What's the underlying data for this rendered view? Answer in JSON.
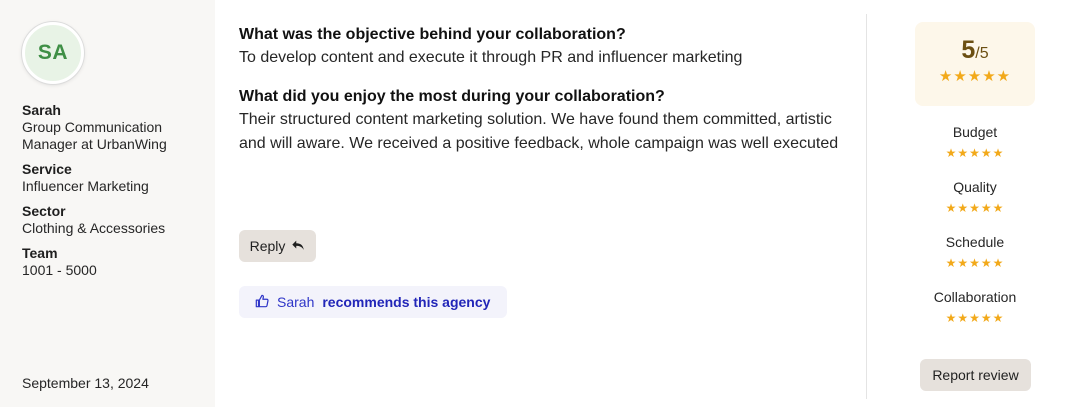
{
  "reviewer": {
    "initials": "SA",
    "name": "Sarah",
    "role": "Group Communication Manager at UrbanWing",
    "service_label": "Service",
    "service": "Influencer Marketing",
    "sector_label": "Sector",
    "sector": "Clothing & Accessories",
    "team_label": "Team",
    "team": "1001 - 5000",
    "date": "September 13, 2024"
  },
  "review": {
    "q1": "What was the objective behind your collaboration?",
    "a1": "To develop content and execute it through PR and influencer marketing",
    "q2": "What did you enjoy the most during your collaboration?",
    "a2": "Their structured content marketing solution. We have found them committed, artistic and will aware. We received a positive feedback, whole campaign was well executed"
  },
  "actions": {
    "reply_label": "Reply",
    "recommend_name": "Sarah",
    "recommend_text": "recommends this agency",
    "report_label": "Report review"
  },
  "rating": {
    "score": "5",
    "out_of": "/5",
    "stars": "★★★★★",
    "value": 5,
    "max": 5,
    "categories": [
      {
        "label": "Budget",
        "stars": "★★★★★",
        "value": 5
      },
      {
        "label": "Quality",
        "stars": "★★★★★",
        "value": 5
      },
      {
        "label": "Schedule",
        "stars": "★★★★★",
        "value": 5
      },
      {
        "label": "Collaboration",
        "stars": "★★★★★",
        "value": 5
      }
    ]
  },
  "icons": {
    "reply": "reply-arrow-icon",
    "recommend": "thumbs-up-icon",
    "star": "star-icon"
  },
  "colors": {
    "star": "#f2a91a",
    "recommend_text": "#2226b8",
    "avatar_text": "#3f8f46",
    "score_text": "#6b4f12"
  }
}
